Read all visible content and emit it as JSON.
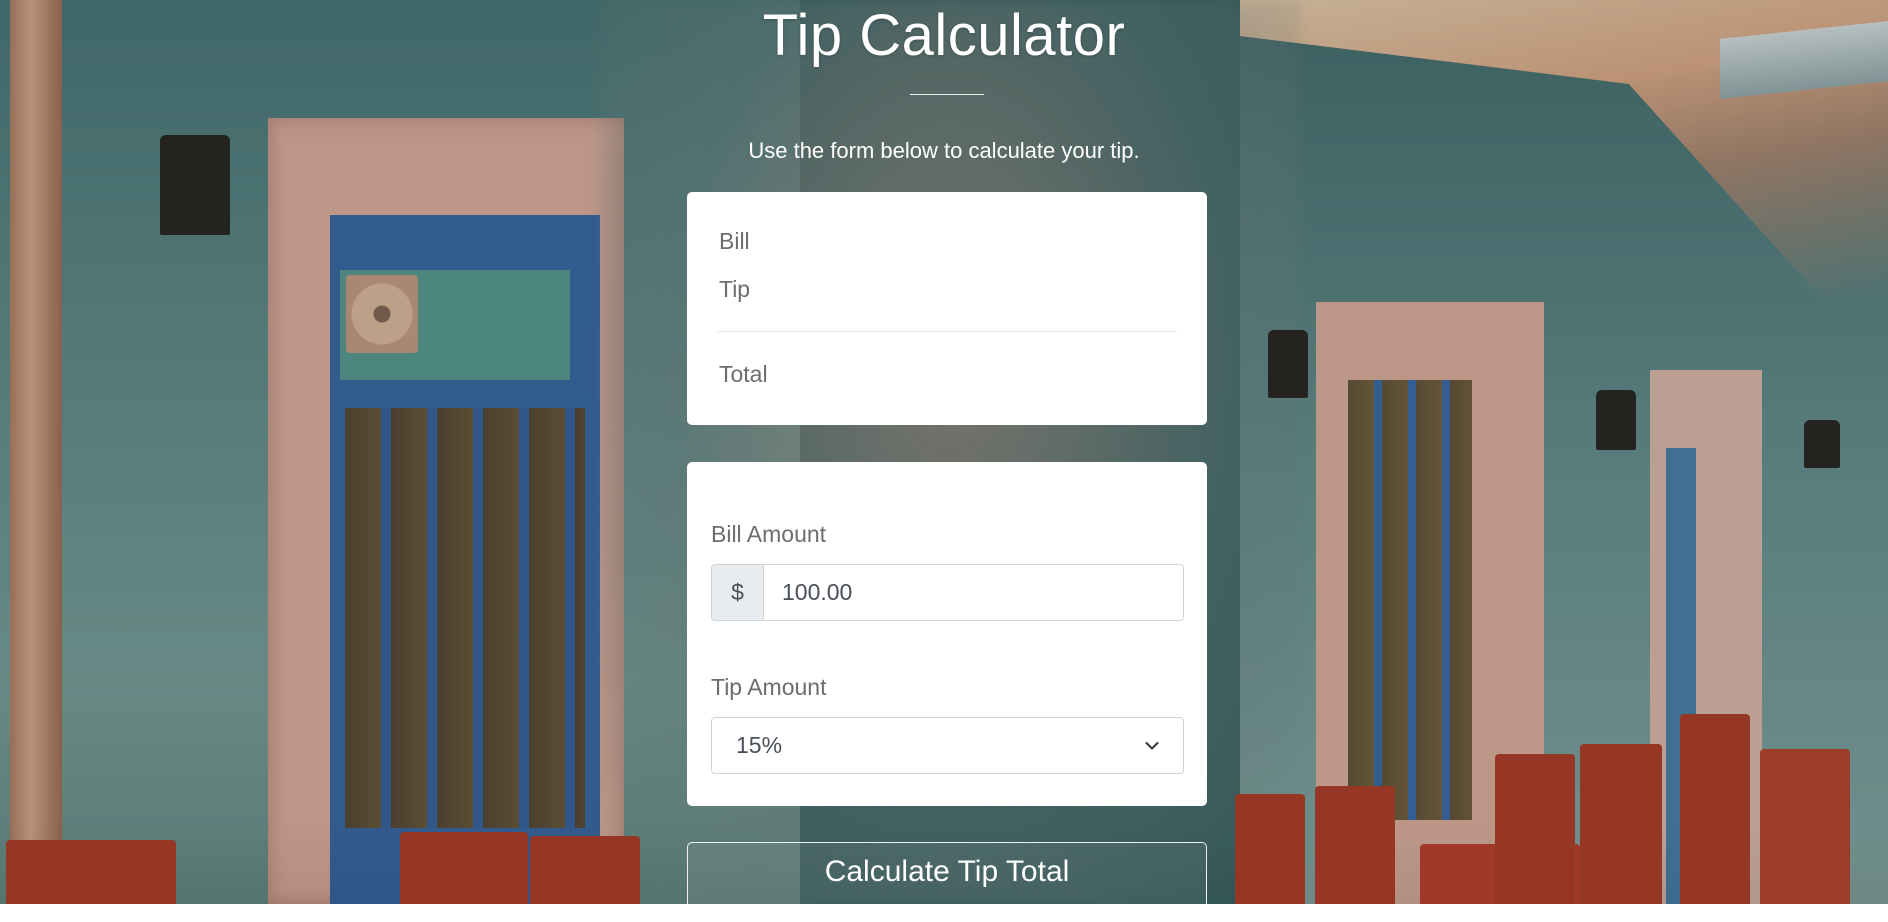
{
  "page": {
    "title": "Tip Calculator",
    "subtitle": "Use the form below to calculate your tip."
  },
  "summary": {
    "bill_label": "Bill",
    "tip_label": "Tip",
    "total_label": "Total"
  },
  "form": {
    "bill_amount_label": "Bill Amount",
    "currency_symbol": "$",
    "bill_amount_value": "100.00",
    "tip_amount_label": "Tip Amount",
    "tip_selected": "15%",
    "calculate_button_label": "Calculate Tip Total"
  },
  "icons": {
    "select_arrow": "chevron-down-icon"
  },
  "colors": {
    "card_background": "#ffffff",
    "label_text": "#6d6d6d",
    "input_text": "#495057",
    "addon_background": "#e9ecef",
    "heading_text": "#ffffff"
  }
}
